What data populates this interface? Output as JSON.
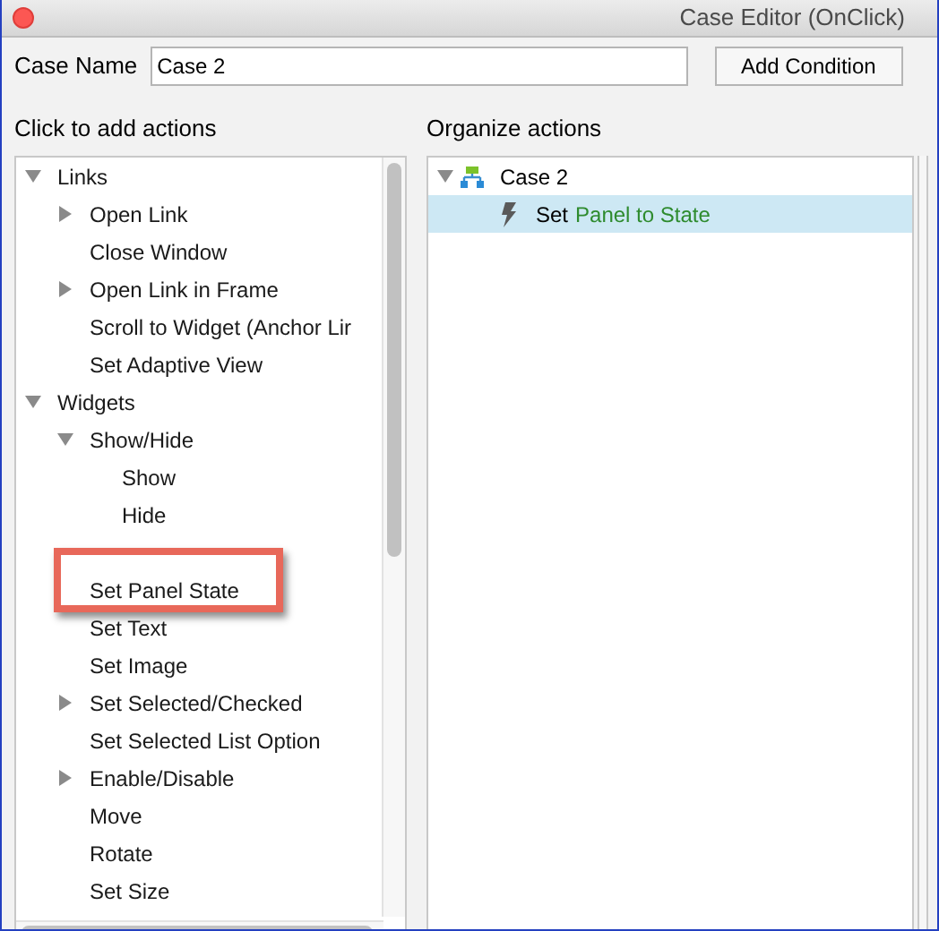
{
  "window": {
    "title": "Case Editor (OnClick)"
  },
  "case_name": {
    "label": "Case Name",
    "value": "Case 2"
  },
  "add_condition_button": "Add Condition",
  "actions_panel": {
    "heading": "Click to add actions",
    "tree": [
      {
        "label": "Links",
        "kind": "folder",
        "expanded": true,
        "children": [
          {
            "label": "Open Link",
            "kind": "folder",
            "expanded": false
          },
          {
            "label": "Close Window",
            "kind": "action"
          },
          {
            "label": "Open Link in Frame",
            "kind": "folder",
            "expanded": false
          },
          {
            "label": "Scroll to Widget (Anchor Lir",
            "kind": "action"
          },
          {
            "label": "Set Adaptive View",
            "kind": "action"
          }
        ]
      },
      {
        "label": "Widgets",
        "kind": "folder",
        "expanded": true,
        "children": [
          {
            "label": "Show/Hide",
            "kind": "folder",
            "expanded": true,
            "children": [
              {
                "label": "Show",
                "kind": "action"
              },
              {
                "label": "Hide",
                "kind": "action"
              }
            ]
          },
          {
            "label": "Set Panel State",
            "kind": "action",
            "highlighted": true
          },
          {
            "label": "Set Text",
            "kind": "action"
          },
          {
            "label": "Set Image",
            "kind": "action"
          },
          {
            "label": "Set Selected/Checked",
            "kind": "folder",
            "expanded": false
          },
          {
            "label": "Set Selected List Option",
            "kind": "action"
          },
          {
            "label": "Enable/Disable",
            "kind": "folder",
            "expanded": false
          },
          {
            "label": "Move",
            "kind": "action"
          },
          {
            "label": "Rotate",
            "kind": "action"
          },
          {
            "label": "Set Size",
            "kind": "action"
          }
        ]
      }
    ]
  },
  "organize_panel": {
    "heading": "Organize actions",
    "case": {
      "label": "Case 2",
      "expanded": true,
      "actions": [
        {
          "verb": "Set",
          "target": "Panel to State",
          "selected": true
        }
      ]
    }
  }
}
